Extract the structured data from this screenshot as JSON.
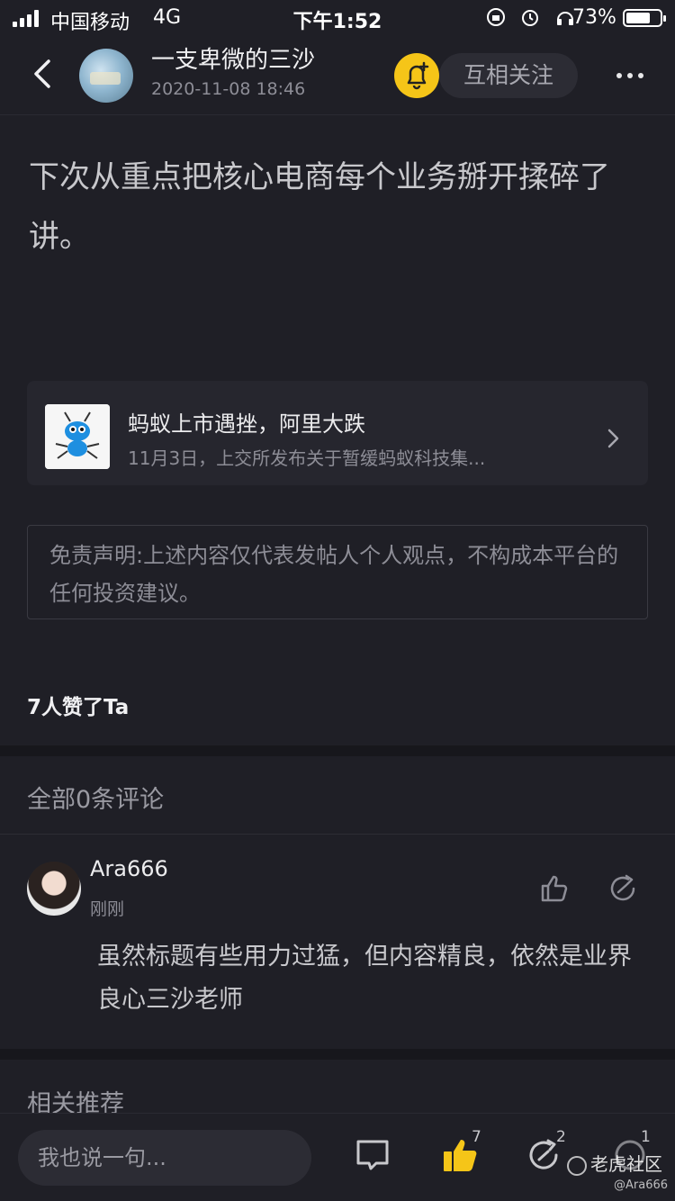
{
  "status_bar": {
    "carrier": "中国移动",
    "network": "4G",
    "time": "下午1:52",
    "battery": "73%",
    "battery_level": 0.73
  },
  "header": {
    "author": "一支卑微的三沙",
    "timestamp": "2020-11-08 18:46",
    "follow_label": "互相关注",
    "accent_color": "#f5c518"
  },
  "post": {
    "text": "下次从重点把核心电商每个业务掰开揉碎了讲。"
  },
  "news_card": {
    "title": "蚂蚁上市遇挫，阿里大跌",
    "summary": "11月3日，上交所发布关于暂缓蚂蚁科技集..."
  },
  "disclaimer": {
    "text": "免责声明:上述内容仅代表发帖人个人观点，不构成本平台的任何投资建议。"
  },
  "likes": {
    "text": "7人赞了Ta"
  },
  "comments": {
    "header": "全部0条评论",
    "items": [
      {
        "user": "Ara666",
        "time": "刚刚",
        "body": "虽然标题有些用力过猛，但内容精良，依然是业界良心三沙老师"
      }
    ]
  },
  "related": {
    "header": "相关推荐"
  },
  "bottom_bar": {
    "input_placeholder": "我也说一句...",
    "like_count": "7",
    "share_count": "2",
    "reward_count": "1",
    "watermark": "老虎社区",
    "watermark_user": "@Ara666"
  }
}
